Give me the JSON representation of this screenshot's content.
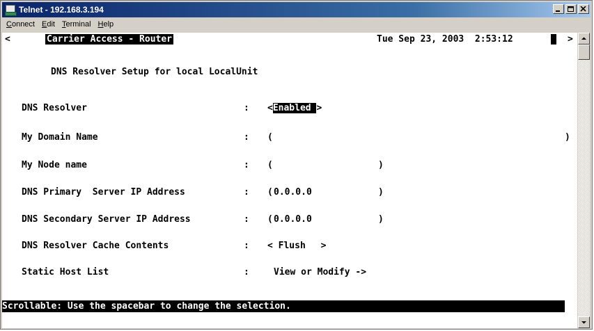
{
  "window": {
    "title": "Telnet - 192.168.3.194"
  },
  "menu": {
    "items": [
      {
        "label": "Connect",
        "underline": "C",
        "rest": "onnect"
      },
      {
        "label": "Edit",
        "underline": "E",
        "rest": "dit"
      },
      {
        "label": "Terminal",
        "underline": "T",
        "rest": "erminal"
      },
      {
        "label": "Help",
        "underline": "H",
        "rest": "elp"
      }
    ]
  },
  "terminal": {
    "header_left_marker": "<",
    "header_product": "Carrier Access - Router",
    "header_datetime": "Tue Sep 23, 2003  2:53:12",
    "header_right_marker": ">",
    "page_title": "DNS Resolver Setup for local LocalUnit",
    "fields": [
      {
        "label": "DNS Resolver",
        "sep": ":",
        "value_open": "<",
        "value": "Enabled ",
        "value_close": ">"
      },
      {
        "label": "My Domain Name",
        "sep": ":",
        "value_open": "(",
        "value": "",
        "value_close": ")"
      },
      {
        "label": "My Node name",
        "sep": ":",
        "value_open": "(",
        "value": "",
        "value_close": ")"
      },
      {
        "label": "DNS Primary  Server IP Address",
        "sep": ":",
        "value_open": "(",
        "value": "0.0.0.0",
        "value_close": ")"
      },
      {
        "label": "DNS Secondary Server IP Address",
        "sep": ":",
        "value_open": "(",
        "value": "0.0.0.0",
        "value_close": ")"
      },
      {
        "label": "DNS Resolver Cache Contents",
        "sep": ":",
        "value_open": "<",
        "value": " Flush ",
        "value_close": ">"
      },
      {
        "label": "Static Host List",
        "sep": ":",
        "value_open": "",
        "value": "View or Modify ->",
        "value_close": ""
      }
    ],
    "status_line": "Scrollable: Use the spacebar to change the selection."
  },
  "icons": {
    "app": "telnet-app-icon",
    "minimize": "minimize-icon",
    "maximize": "maximize-icon",
    "close": "close-icon",
    "scroll_up": "scroll-up-arrow-icon",
    "scroll_down": "scroll-down-arrow-icon"
  }
}
